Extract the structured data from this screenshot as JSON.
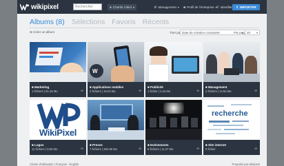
{
  "app": {
    "name": "wikipixel"
  },
  "topbar": {
    "search_placeholder": "Rechercher",
    "nav": [
      {
        "label": "Charlie Client",
        "icon": "user-icon"
      },
      {
        "label": "Management",
        "icon": "gear-icon"
      },
      {
        "label": "Profil de l'entreprise",
        "icon": "building-icon"
      },
      {
        "label": "Identifiant",
        "icon": "key-icon"
      }
    ],
    "import_label": "IMPORTER"
  },
  "tabs": [
    {
      "label": "Albums (8)",
      "active": true
    },
    {
      "label": "Sélections",
      "active": false
    },
    {
      "label": "Favoris",
      "active": false
    },
    {
      "label": "Récents",
      "active": false
    }
  ],
  "toolbar": {
    "create_label": "Créer un album",
    "sort_label": "Trier par",
    "sort_value": "Date de création croissante",
    "per_page_label": "Par page",
    "per_page_value": "20"
  },
  "albums": [
    {
      "title": "Marketing",
      "stats": "1 fichiers | 81.26 Mo"
    },
    {
      "title": "Applications mobiles",
      "stats": "2 fichiers | 16.04 Mo"
    },
    {
      "title": "Publicité",
      "stats": "1 fichier | 4.24 Mo"
    },
    {
      "title": "Management",
      "stats": "2 fichiers | 13.62 Mo"
    },
    {
      "title": "Logos",
      "stats": "11 fichiers | 8.83 Mo"
    },
    {
      "title": "Presse",
      "stats": "7 fichiers | 384.96 Mo"
    },
    {
      "title": "Evénements",
      "stats": "6 fichiers | 11.37 Mo"
    },
    {
      "title": "Site internet",
      "stats": "0 fichier"
    }
  ],
  "thumbs": {
    "logos_text": "WikiPixel",
    "site_word": "recherche"
  },
  "footer": {
    "left": "Charte d'utilisation | Français - English",
    "right": "Propulsé par wikipixel"
  },
  "colors": {
    "accent": "#3a8ad6",
    "topbar": "#2b3440",
    "background": "#eef0f2"
  }
}
